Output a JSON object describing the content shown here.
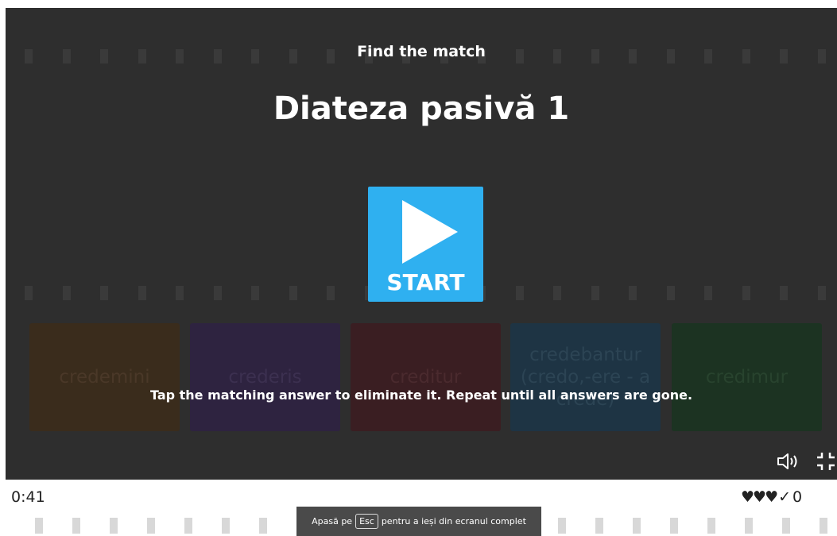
{
  "game": {
    "subtitle": "Find the match",
    "title": "Diateza pasivă 1",
    "start_label": "START",
    "instructions": "Tap the matching answer to eliminate it. Repeat until all answers are gone.",
    "tiles": [
      {
        "text": "credemini",
        "bg": "#3a2c1c",
        "fg": "#4a3828"
      },
      {
        "text": "crederis",
        "bg": "#2e2340",
        "fg": "#3c3050"
      },
      {
        "text": "creditur",
        "bg": "#3a1e22",
        "fg": "#4a2a2e"
      },
      {
        "text": "credebantur (credo,-ere - a crede)",
        "bg": "#1e3444",
        "fg": "#2c4454"
      },
      {
        "text": "credimur",
        "bg": "#1c3322",
        "fg": "#28432e"
      }
    ],
    "icons": {
      "sound": "speaker-icon",
      "fullscreen": "exit-fullscreen-icon"
    }
  },
  "footer": {
    "timer": "0:41",
    "hearts": "♥♥♥",
    "check": "✓",
    "score": "0"
  },
  "toast": {
    "prefix": "Apasă pe",
    "key": "Esc",
    "suffix": "pentru a ieși din ecranul complet"
  }
}
